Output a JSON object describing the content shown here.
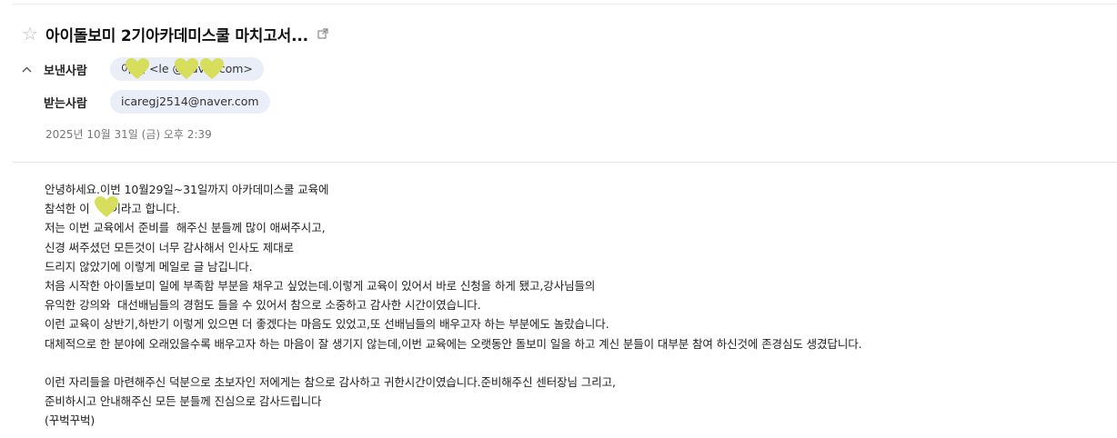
{
  "subject": "아이돌보미 2기아카데미스쿨 마치고서...",
  "from_label": "보낸사람",
  "from_value": "이   렌 <le          @naver.com>",
  "to_label": "받는사람",
  "to_value": "icaregj2514@naver.com",
  "date": "2025년 10월 31일 (금) 오후 2:39",
  "body_lines": [
    "안녕하세요.이번 10월29일~31일까지 아카데미스쿨 교육에",
    "참석한 이   렌이라고 합니다.",
    "저는 이번 교육에서 준비를  해주신 분들께 많이 애써주시고,",
    "신경 써주셨던 모든것이 너무 감사해서 인사도 제대로",
    "드리지 않았기에 이렇게 메일로 글 남깁니다.",
    "처음 시작한 아이돌보미 일에 부족함 부분을 채우고 싶었는데.이렇게 교육이 있어서 바로 신청을 하게 됐고,강사님들의",
    "유익한 강의와  대선배님들의 경험도 들을 수 있어서 참으로 소중하고 감사한 시간이였습니다.",
    "이런 교육이 상반기,하반기 이렇게 있으면 더 좋겠다는 마음도 있었고,또 선배님들의 배우고자 하는 부분에도 놀랐습니다.",
    "대체적으로 한 분야에 오래있을수록 배우고자 하는 마음이 잘 생기지 않는데,이번 교육에는 오랫동안 돌보미 일을 하고 계신 분들이 대부분 참여 하신것에 존경심도 생겼답니다.",
    "",
    "이런 자리들을 마련해주신 덕분으로 초보자인 저에게는 참으로 감사하고 귀한시간이였습니다.준비해주신 센터장님 그리고,",
    "준비하시고 안내해주신 모든 분들께 진심으로 감사드립니다",
    "(꾸벅꾸벅)"
  ],
  "icons": {
    "star": "star-outline-icon",
    "external": "external-link-icon",
    "collapse": "chevron-up-icon",
    "redaction": "heart-sticker-icon"
  },
  "colors": {
    "chip_bg": "#e9eef8",
    "heart": "#d6de5c",
    "star": "#b9b9b9"
  }
}
